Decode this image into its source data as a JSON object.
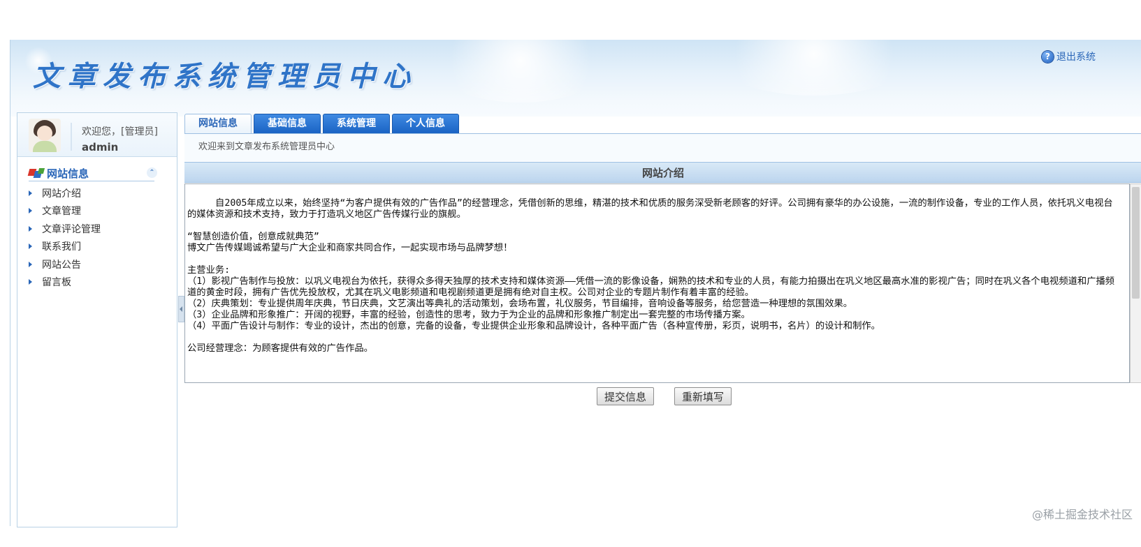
{
  "header": {
    "title": "文章发布系统管理员中心",
    "logout_label": "退出系统",
    "logout_icon": "help-circle-icon"
  },
  "user": {
    "welcome": "欢迎您，[管理员]",
    "name": "admin"
  },
  "nav": {
    "title": "网站信息",
    "items": [
      {
        "label": "网站介绍"
      },
      {
        "label": "文章管理"
      },
      {
        "label": "文章评论管理"
      },
      {
        "label": "联系我们"
      },
      {
        "label": "网站公告"
      },
      {
        "label": "留言板"
      }
    ]
  },
  "tabs": [
    {
      "label": "网站信息",
      "active": true
    },
    {
      "label": "基础信息",
      "active": false
    },
    {
      "label": "系统管理",
      "active": false
    },
    {
      "label": "个人信息",
      "active": false
    }
  ],
  "breadcrumb": "欢迎来到文章发布系统管理员中心",
  "panel": {
    "title": "网站介绍",
    "content": {
      "p1": "     自2005年成立以来，始终坚持“为客户提供有效的广告作品”的经营理念，凭借创新的思维，精湛的技术和优质的服务深受新老顾客的好评。公司拥有豪华的办公设施，一流的制作设备，专业的工作人员，依托巩义电视台的媒体资源和技术支持，致力于打造巩义地区广告传媒行业的旗舰。",
      "slogan": "“智慧创造价值，创意成就典范”",
      "p2": "博文广告传媒竭诚希望与广大企业和商家共同合作，一起实现市场与品牌梦想！",
      "business_title": "主营业务:",
      "b1": "（1）影视广告制作与投放：以巩义电视台为依托，获得众多得天独厚的技术支持和媒体资源——凭借一流的影像设备，娴熟的技术和专业的人员，有能力拍摄出在巩义地区最高水准的影视广告；同时在巩义各个电视频道和广播频道的黄金时段，拥有广告优先投放权，尤其在巩义电影频道和电视剧频道更是拥有绝对自主权。公司对企业的专题片制作有着丰富的经验。",
      "b2": "（2）庆典策划：专业提供周年庆典，节日庆典，文艺演出等典礼的活动策划，会场布置，礼仪服务，节目编排，音响设备等服务，给您营造一种理想的氛围效果。",
      "b3": "（3）企业品牌和形象推广：开阔的视野，丰富的经验，创造性的思考，致力于为企业的品牌和形象推广制定出一套完整的市场传播方案。",
      "b4": "（4）平面广告设计与制作：专业的设计，杰出的创意，完备的设备，专业提供企业形象和品牌设计，各种平面广告（各种宣传册，彩页，说明书，名片）的设计和制作。",
      "philosophy": "公司经营理念：为顾客提供有效的广告作品。"
    }
  },
  "buttons": {
    "submit": "提交信息",
    "reset": "重新填写"
  },
  "watermark": "@稀土掘金技术社区"
}
